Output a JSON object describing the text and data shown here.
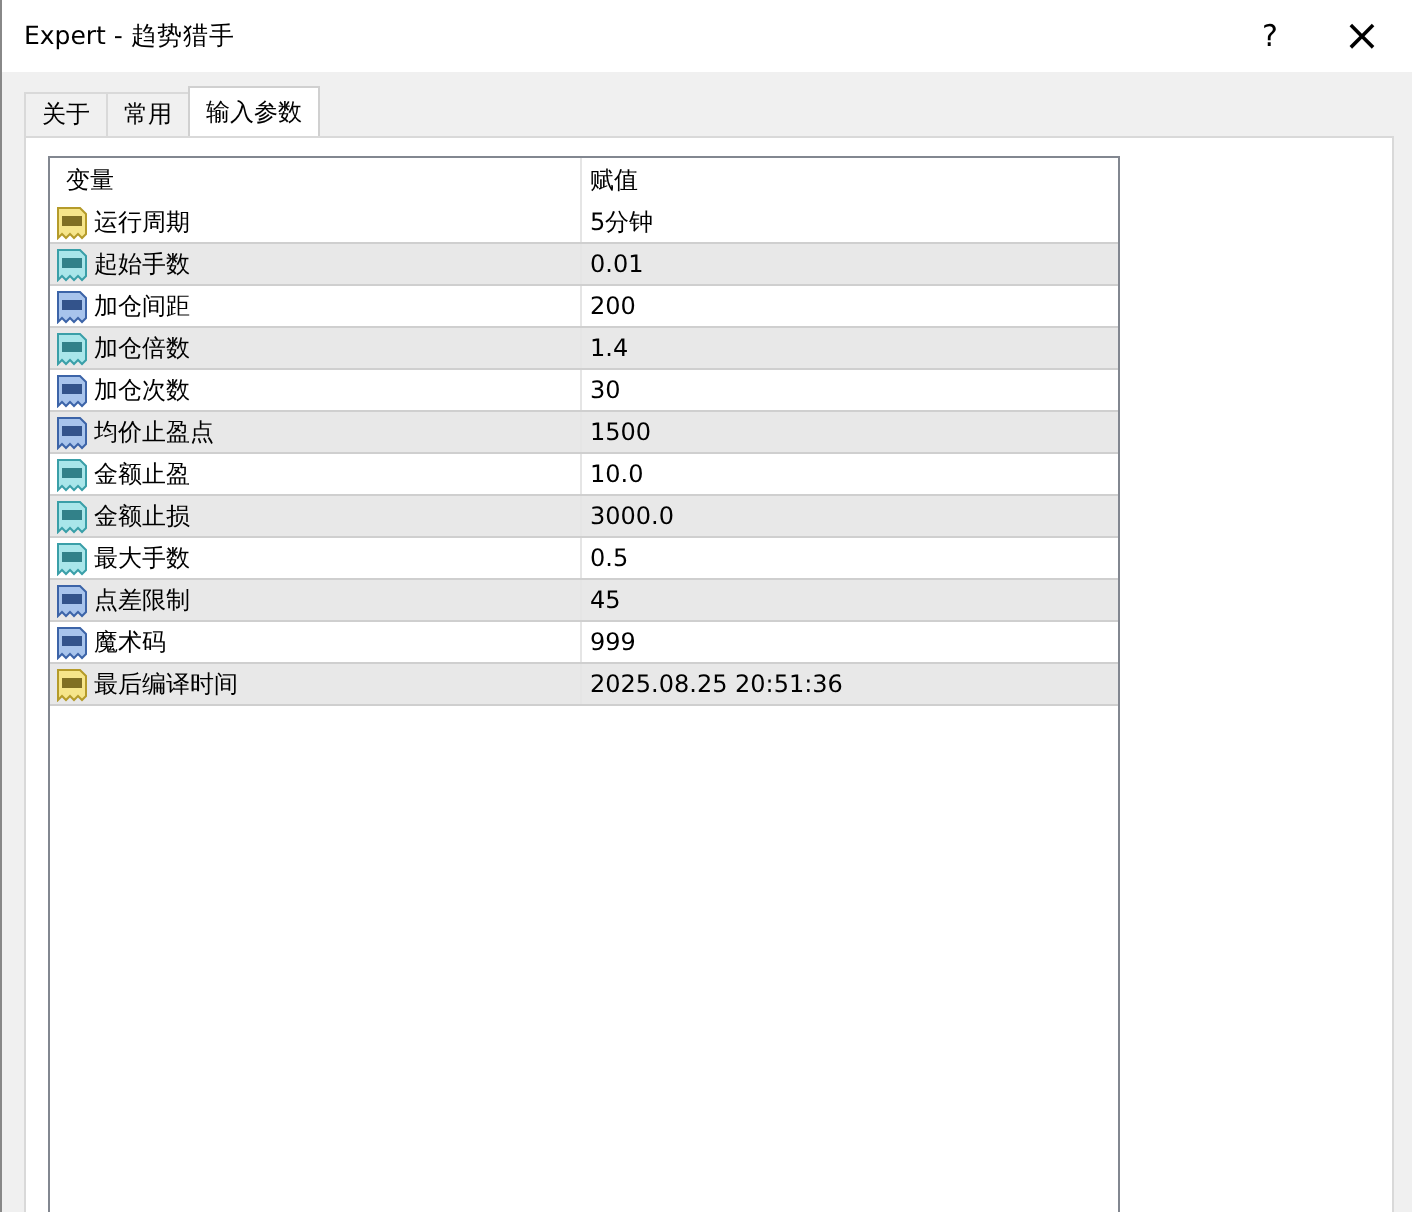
{
  "window": {
    "title": "Expert - 趋势猎手",
    "help": "?",
    "close": "×"
  },
  "tabs": [
    {
      "label": "关于",
      "selected": false
    },
    {
      "label": "常用",
      "selected": false
    },
    {
      "label": "输入参数",
      "selected": true
    }
  ],
  "table": {
    "columns": [
      "变量",
      "赋值"
    ],
    "rows": [
      {
        "kind": "string",
        "name": "运行周期",
        "value": "5分钟"
      },
      {
        "kind": "double",
        "name": "起始手数",
        "value": "0.01"
      },
      {
        "kind": "int",
        "name": "加仓间距",
        "value": "200"
      },
      {
        "kind": "double",
        "name": "加仓倍数",
        "value": "1.4"
      },
      {
        "kind": "int",
        "name": "加仓次数",
        "value": "30"
      },
      {
        "kind": "int",
        "name": "均价止盈点",
        "value": "1500"
      },
      {
        "kind": "double",
        "name": "金额止盈",
        "value": "10.0"
      },
      {
        "kind": "double",
        "name": "金额止损",
        "value": "3000.0"
      },
      {
        "kind": "double",
        "name": "最大手数",
        "value": "0.5"
      },
      {
        "kind": "int",
        "name": "点差限制",
        "value": "45"
      },
      {
        "kind": "int",
        "name": "魔术码",
        "value": "999"
      },
      {
        "kind": "string",
        "name": "最后编译时间",
        "value": "2025.08.25 20:51:36"
      }
    ]
  }
}
